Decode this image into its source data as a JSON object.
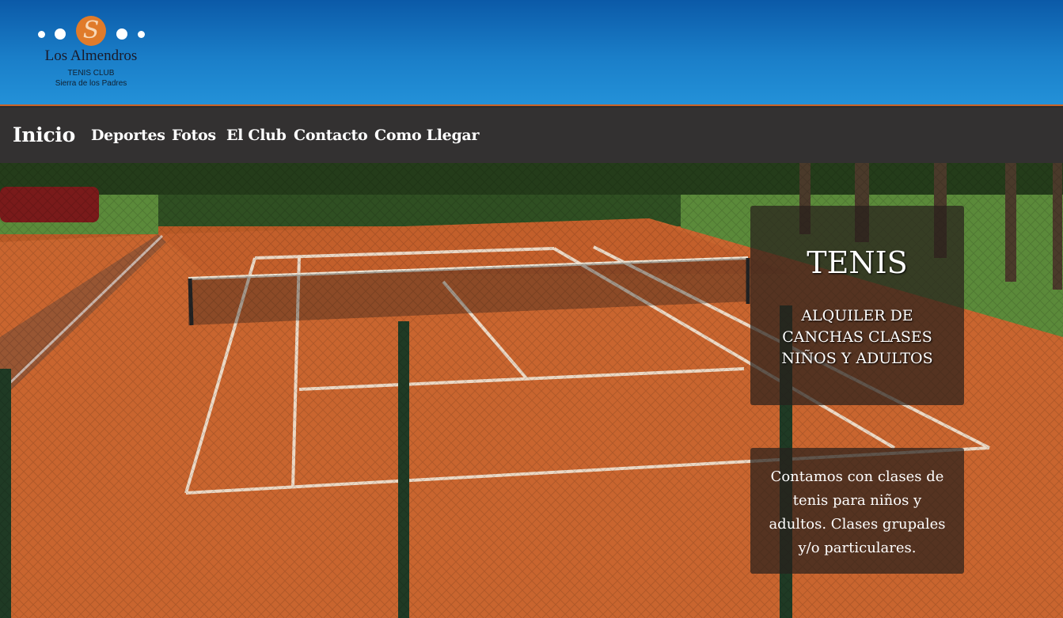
{
  "brand": {
    "name": "Los Almendros",
    "subtitle_line1": "TENIS CLUB",
    "subtitle_line2": "Sierra de los Padres",
    "logo_letter": "S"
  },
  "nav": {
    "home": "Inicio",
    "items": [
      "Deportes",
      "Fotos",
      "El Club",
      "Contacto",
      "Como Llegar"
    ]
  },
  "hero": {
    "image_icon": "tennis-court-photo"
  },
  "feature": {
    "title": "TENIS",
    "subtitle": "ALQUILER DE CANCHAS CLASES NIÑOS Y ADULTOS",
    "description": "Contamos con clases de tenis para niños y adultos. Clases grupales y/o particulares."
  },
  "colors": {
    "header_blue": "#1a7ec8",
    "nav_bg": "#333131",
    "accent_orange": "#e07b2a",
    "clay": "#c86430"
  }
}
